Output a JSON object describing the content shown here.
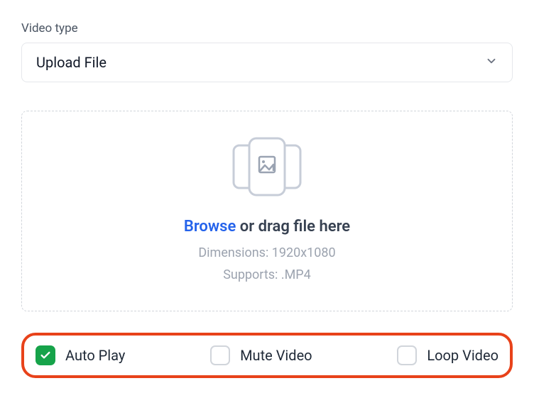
{
  "videoType": {
    "label": "Video type",
    "selected": "Upload File"
  },
  "dropzone": {
    "browse": "Browse",
    "rest": " or drag file here",
    "dimensions": "Dimensions: 1920x1080",
    "supports": "Supports: .MP4"
  },
  "options": {
    "autoPlay": {
      "label": "Auto Play",
      "checked": true
    },
    "muteVideo": {
      "label": "Mute Video",
      "checked": false
    },
    "loopVideo": {
      "label": "Loop Video",
      "checked": false
    }
  }
}
